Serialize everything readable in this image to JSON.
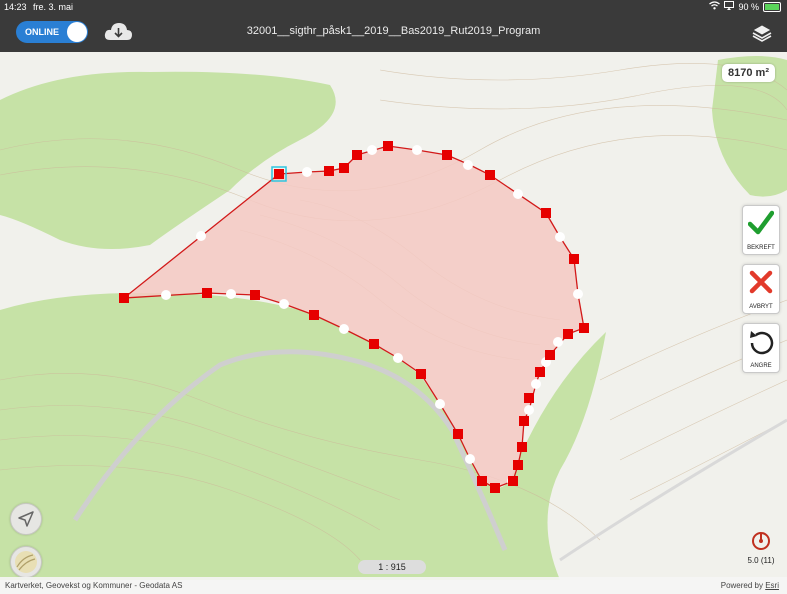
{
  "status_bar": {
    "time": "14:23",
    "day": "fre. 3. mai",
    "battery": "90 %"
  },
  "toolbar": {
    "online_label": "ONLINE",
    "title": "32001__sigthr_påsk1__2019__Bas2019_Rut2019_Program"
  },
  "map": {
    "area": "8170 m²",
    "scale": "1 : 915",
    "attribution_left": "Kartverket, Geovekst og Kommuner - Geodata AS",
    "attribution_powered": "Powered by",
    "attribution_esri": "Esri",
    "gps_accuracy": "5.0 (11)"
  },
  "actions": {
    "confirm": "BEKREFT",
    "cancel": "AVBRYT",
    "undo": "ANGRE"
  },
  "colors": {
    "polygon_fill": "#f5c9c3",
    "polygon_stroke": "#d21a1a",
    "vertex": "#e60000",
    "forest": "#c6e2a6",
    "road": "#cfcfcf",
    "toolbar": "#3a3a3a",
    "accent": "#2a7fd4"
  }
}
